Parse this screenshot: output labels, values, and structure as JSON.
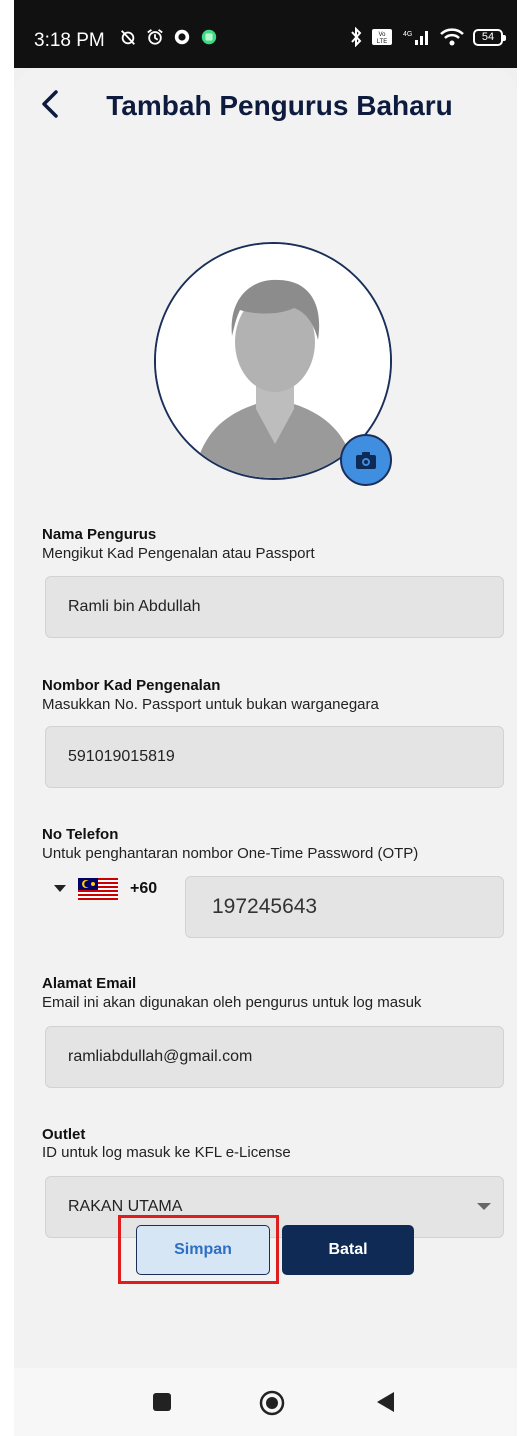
{
  "status_bar": {
    "time": "3:18 PM",
    "battery": "54"
  },
  "header": {
    "title": "Tambah Pengurus Baharu"
  },
  "form": {
    "name": {
      "label": "Nama Pengurus",
      "help": "Mengikut Kad Pengenalan atau Passport",
      "value": "Ramli bin Abdullah"
    },
    "ic_number": {
      "label": "Nombor Kad Pengenalan",
      "help": "Masukkan No. Passport untuk bukan warganegara",
      "value": "591019015819"
    },
    "phone": {
      "label": "No Telefon",
      "help": "Untuk penghantaran nombor One-Time Password (OTP)",
      "country_code": "+60",
      "value": "197245643"
    },
    "email": {
      "label": "Alamat Email",
      "help": "Email ini akan digunakan oleh pengurus untuk log masuk",
      "value": "ramliabdullah@gmail.com"
    },
    "outlet": {
      "label": "Outlet",
      "help": "ID untuk log masuk ke KFL e-License",
      "value": "RAKAN UTAMA"
    }
  },
  "actions": {
    "save_label": "Simpan",
    "cancel_label": "Batal"
  },
  "colors": {
    "title": "#0d1b3e",
    "primary": "#0e2a55",
    "camera": "#3f8ee0",
    "highlight": "#e01d1d"
  }
}
